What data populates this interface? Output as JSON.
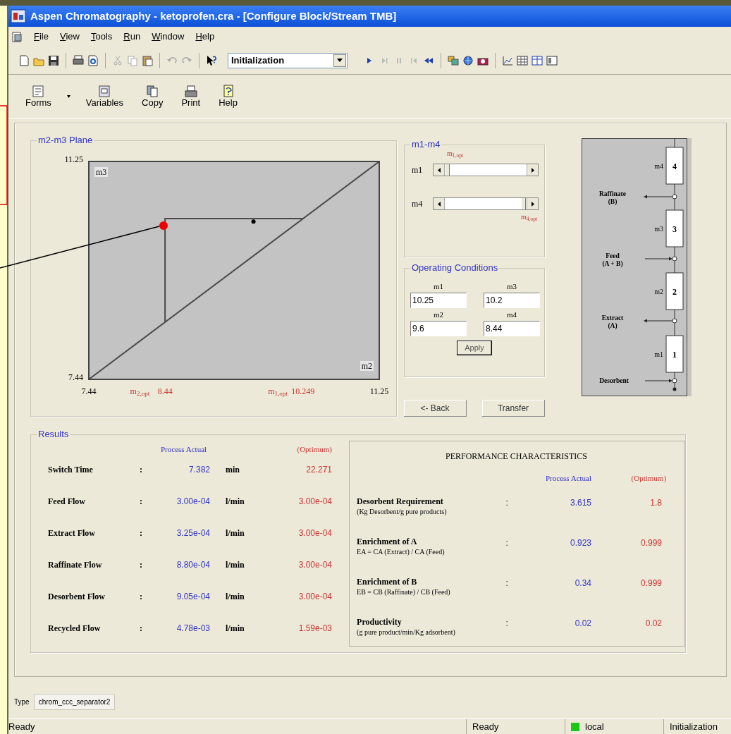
{
  "window": {
    "title": "Aspen Chromatography - ketoprofen.cra - [Configure Block/Stream TMB]"
  },
  "menu": [
    "File",
    "View",
    "Tools",
    "Run",
    "Window",
    "Help"
  ],
  "toolbar": {
    "mode": "Initialization"
  },
  "form_toolbar": [
    {
      "label": "Forms",
      "kind": "forms"
    },
    {
      "label": "Variables",
      "kind": "variables"
    },
    {
      "label": "Copy",
      "kind": "copy"
    },
    {
      "label": "Print",
      "kind": "print"
    },
    {
      "label": "Help",
      "kind": "help"
    }
  ],
  "plane": {
    "chart_data": {
      "type": "line",
      "title": "m2-m3 Plane",
      "xlabel": "m2",
      "ylabel": "m3",
      "xlim": [
        7.44,
        11.25
      ],
      "ylim": [
        7.44,
        11.25
      ],
      "xticks": [
        7.44,
        8.44,
        10.249,
        11.25
      ],
      "yticks": [
        7.44,
        11.25
      ],
      "series": [
        {
          "x": [
            7.44,
            11.25
          ],
          "values": [
            7.44,
            11.25
          ]
        },
        {
          "x": [
            8.44,
            8.44,
            10.25
          ],
          "values": [
            8.44,
            10.25,
            10.25
          ]
        },
        {
          "x": [
            9.6
          ],
          "values": [
            10.2
          ],
          "marker": "circle"
        }
      ],
      "annotations": [
        "m$_{2,opt}$",
        "m$_{1,opt}$"
      ]
    }
  },
  "m1_m4": {
    "title": "m1-m4",
    "sliders": [
      {
        "label": "m1",
        "optimum_label": "m$_{1,opt}$"
      },
      {
        "label": "m4",
        "optimum_label": "m$_{4,opt}$"
      }
    ]
  },
  "operating_conditions": {
    "title": "Operating Conditions",
    "fields": [
      {
        "label": "m1",
        "value": "10.25"
      },
      {
        "label": "m3",
        "value": "10.2"
      },
      {
        "label": "m2",
        "value": "9.6"
      },
      {
        "label": "m4",
        "value": "8.44"
      }
    ],
    "apply": "Apply"
  },
  "buttons": [
    "<- Back",
    "Transfer"
  ],
  "column": {
    "sections": [
      {
        "label": "m4",
        "number": "4"
      },
      {
        "label": "m3",
        "number": "3"
      },
      {
        "label": "m2",
        "number": "2"
      },
      {
        "label": "m1",
        "number": "1"
      }
    ],
    "streams": [
      {
        "name": "Raffinate",
        "detail": "(B)",
        "kind": "outlet"
      },
      {
        "name": "Feed",
        "detail": "(A + B)",
        "kind": "inlet"
      },
      {
        "name": "Extract",
        "detail": "(A)",
        "kind": "outlet"
      },
      {
        "name": "Desorbent",
        "kind": "inlet"
      }
    ]
  },
  "results": {
    "title": "Results",
    "actual_heading": "Process Actual",
    "optimum_heading": "(Optimum)",
    "rows": [
      {
        "label": "Switch Time",
        "colon": ":",
        "actual": "7.382",
        "unit": "min",
        "optimum": "22.271"
      },
      {
        "label": "Feed Flow",
        "colon": ":",
        "actual": "3.00e-04",
        "unit": "l/min",
        "optimum": "3.00e-04"
      },
      {
        "label": "Extract Flow",
        "colon": ":",
        "actual": "3.25e-04",
        "unit": "l/min",
        "optimum": "3.00e-04"
      },
      {
        "label": "Raffinate Flow",
        "colon": ":",
        "actual": "8.80e-04",
        "unit": "l/min",
        "optimum": "3.00e-04"
      },
      {
        "label": "Desorbent Flow",
        "colon": ":",
        "actual": "9.05e-04",
        "unit": "l/min",
        "optimum": "3.00e-04"
      },
      {
        "label": "Recycled Flow",
        "colon": ":",
        "actual": "4.78e-03",
        "unit": "l/min",
        "optimum": "1.59e-03"
      }
    ]
  },
  "performance": {
    "title": "PERFORMANCE CHARACTERISTICS",
    "actual_heading": "Process Actual",
    "optimum_heading": "(Optimum)",
    "rows": [
      {
        "label": "Desorbent Requirement",
        "note": "(Kg Desorbent/g pure products)",
        "colon": ":",
        "actual": "3.615",
        "optimum": "1.8"
      },
      {
        "label": "Enrichment of A",
        "note": "EA = CA (Extract) / CA (Feed)",
        "colon": ":",
        "actual": "0.923",
        "optimum": "0.999"
      },
      {
        "label": "Enrichment of B",
        "note": "EB = CB (Raffinate) / CB (Feed)",
        "colon": ":",
        "actual": "0.34",
        "optimum": "0.999"
      },
      {
        "label": "Productivity",
        "note": "(g pure product/min/Kg adsorbent)",
        "colon": ":",
        "actual": "0.02",
        "optimum": "0.02"
      }
    ]
  },
  "type_field": {
    "label": "Type",
    "value": "chrom_ccc_separator2"
  },
  "status_bar": {
    "message": "Ready",
    "panes": [
      {
        "text": "Ready"
      },
      {
        "text": "local",
        "color": "#19c819"
      },
      {
        "text": "Initialization"
      }
    ]
  }
}
